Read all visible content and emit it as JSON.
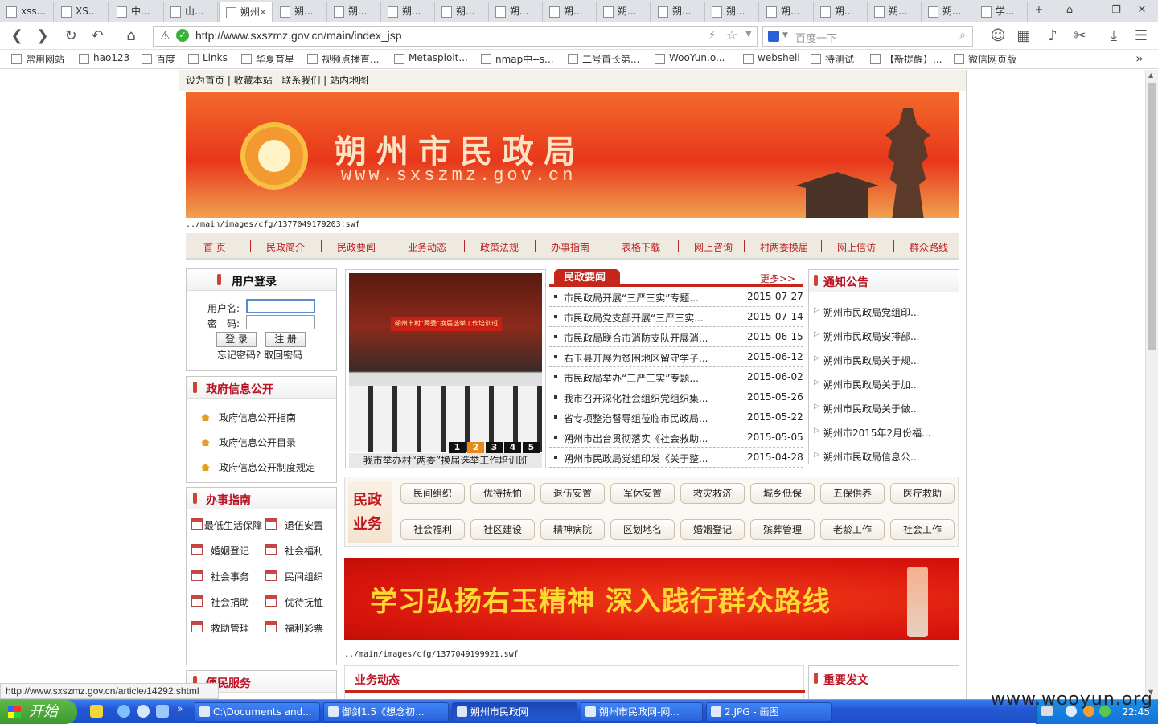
{
  "browser": {
    "tabs": [
      {
        "label": "xss..."
      },
      {
        "label": "XS..."
      },
      {
        "label": "中..."
      },
      {
        "label": "山..."
      },
      {
        "label": "朔州"
      },
      {
        "label": "朔..."
      },
      {
        "label": "朔..."
      },
      {
        "label": "朔..."
      },
      {
        "label": "朔..."
      },
      {
        "label": "朔..."
      },
      {
        "label": "朔..."
      },
      {
        "label": "朔..."
      },
      {
        "label": "朔..."
      },
      {
        "label": "朔..."
      },
      {
        "label": "朔..."
      },
      {
        "label": "朔..."
      },
      {
        "label": "朔..."
      },
      {
        "label": "朔..."
      },
      {
        "label": "学..."
      }
    ],
    "tab_close": "×",
    "new_tab": "+",
    "url": "http://www.sxszmz.gov.cn/main/index_jsp",
    "search_placeholder": "百度一下",
    "bookmarks": [
      {
        "label": "常用网站"
      },
      {
        "label": "hao123"
      },
      {
        "label": "百度"
      },
      {
        "label": "Links"
      },
      {
        "label": "华夏育星"
      },
      {
        "label": "视频点播直..."
      },
      {
        "label": "Metasploit..."
      },
      {
        "label": "nmap中--s..."
      },
      {
        "label": "二号首长第..."
      },
      {
        "label": "WooYun.o..."
      },
      {
        "label": "webshell"
      },
      {
        "label": "待测试"
      },
      {
        "label": "【新提醒】..."
      },
      {
        "label": "微信网页版"
      }
    ],
    "bookmarks_more": "»",
    "status_url": "http://www.sxszmz.gov.cn/article/14292.shtml"
  },
  "site": {
    "top_links": "设为首页 | 收藏本站 | 联系我们 | 站内地图",
    "banner": {
      "title": "朔州市民政局",
      "domain": "www.sxszmz.gov.cn"
    },
    "swf_note_1": "../main/images/cfg/1377049179203.swf",
    "swf_note_2": "../main/images/cfg/1377049199921.swf",
    "nav": [
      "首 页",
      "民政简介",
      "民政要闻",
      "业务动态",
      "政策法规",
      "办事指南",
      "表格下载",
      "网上咨询",
      "村两委换届",
      "网上信访",
      "群众路线"
    ],
    "login": {
      "title": "用户登录",
      "username_label": "用户名:",
      "password_label": "密　码:",
      "login_button": "登 录",
      "register_button": "注 册",
      "forgot": "忘记密码? 取回密码"
    },
    "gov_info": {
      "title": "政府信息公开",
      "items": [
        "政府信息公开指南",
        "政府信息公开目录",
        "政府信息公开制度规定"
      ]
    },
    "guide": {
      "title": "办事指南",
      "items": [
        "最低生活保障",
        "退伍安置",
        "婚姻登记",
        "社会福利",
        "社会事务",
        "民间组织",
        "社会捐助",
        "优待抚恤",
        "救助管理",
        "福利彩票"
      ]
    },
    "convenience": {
      "title": "便民服务"
    },
    "photo": {
      "caption": "我市举办村“两委”换届选举工作培训班",
      "pages": [
        "1",
        "2",
        "3",
        "4",
        "5"
      ],
      "active_page": "2",
      "stage_text": "朔州市村“两委”换届选举工作培训班"
    },
    "news": {
      "title": "民政要闻",
      "more": "更多>>",
      "items": [
        {
          "title": "市民政局开展“三严三实”专题...",
          "date": "2015-07-27"
        },
        {
          "title": "市民政局党支部开展“三严三实...",
          "date": "2015-07-14"
        },
        {
          "title": "市民政局联合市消防支队开展消...",
          "date": "2015-06-15"
        },
        {
          "title": "右玉县开展为贫困地区留守学子...",
          "date": "2015-06-12"
        },
        {
          "title": "市民政局举办“三严三实”专题...",
          "date": "2015-06-02"
        },
        {
          "title": "我市召开深化社会组织党组织集...",
          "date": "2015-05-26"
        },
        {
          "title": "省专项整治督导组莅临市民政局...",
          "date": "2015-05-22"
        },
        {
          "title": "朔州市出台贯彻落实《社会救助...",
          "date": "2015-05-05"
        },
        {
          "title": "朔州市民政局党组印发《关于整...",
          "date": "2015-04-28"
        }
      ]
    },
    "notice": {
      "title": "通知公告",
      "items": [
        "朔州市民政局党组印...",
        "朔州市民政局安排部...",
        "朔州市民政局关于规...",
        "朔州市民政局关于加...",
        "朔州市民政局关于做...",
        "朔州市2015年2月份福...",
        "朔州市民政局信息公..."
      ]
    },
    "services": {
      "label_1": "民政",
      "label_2": "业务",
      "row1": [
        "民间组织",
        "优待抚恤",
        "退伍安置",
        "军休安置",
        "救灾救济",
        "城乡低保",
        "五保供养",
        "医疗救助"
      ],
      "row2": [
        "社会福利",
        "社区建设",
        "精神病院",
        "区划地名",
        "婚姻登记",
        "殡葬管理",
        "老龄工作",
        "社会工作"
      ]
    },
    "slogan": "学习弘扬右玉精神 深入践行群众路线",
    "business_title": "业务动态",
    "important_title": "重要发文"
  },
  "taskbar": {
    "start": "开始",
    "tasks": [
      {
        "label": "C:\\Documents and..."
      },
      {
        "label": "御剑1.5《想念初..."
      },
      {
        "label": "朔州市民政网"
      },
      {
        "label": "朔州市民政网-网..."
      },
      {
        "label": "2.JPG - 画图"
      }
    ],
    "clock": "22:45"
  },
  "watermark": "www.wooyun.org",
  "colors": {
    "accent_red": "#b11a1a",
    "banner_orange": "#e8371b",
    "taskbar_blue": "#2457d6"
  }
}
